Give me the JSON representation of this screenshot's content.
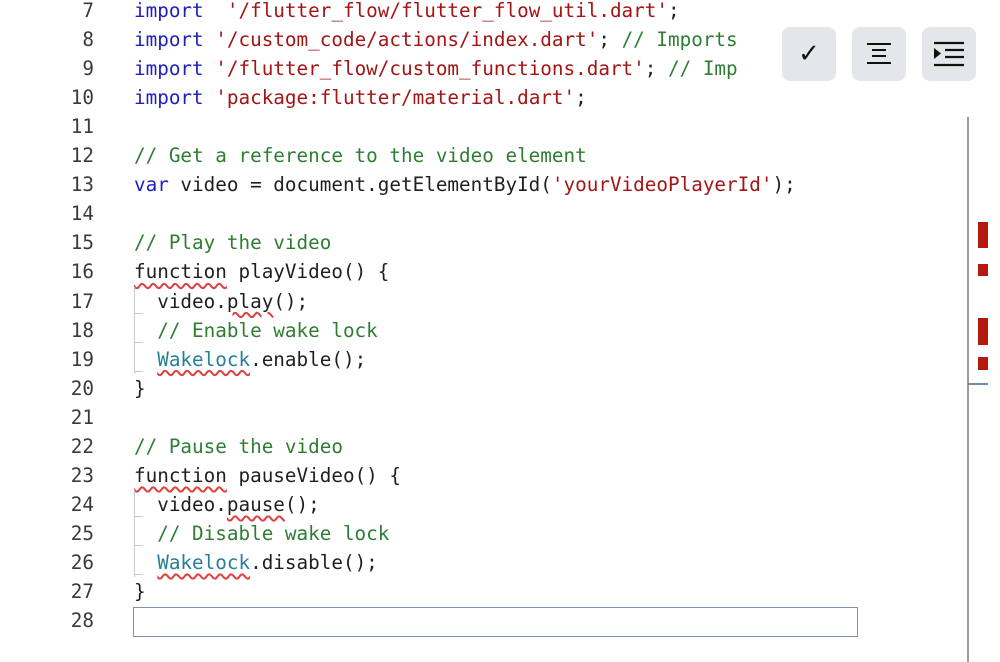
{
  "editor": {
    "lines": [
      {
        "n": "7",
        "tokens": [
          [
            "kw",
            "import"
          ],
          [
            "",
            "  "
          ],
          [
            "str",
            "'/flutter_flow/flutter_flow_util.dart'"
          ],
          [
            "",
            ";"
          ]
        ]
      },
      {
        "n": "8",
        "tokens": [
          [
            "kw",
            "import"
          ],
          [
            "",
            " "
          ],
          [
            "str",
            "'/custom_code/actions/index.dart'"
          ],
          [
            "",
            "; "
          ],
          [
            "com",
            "// Imports"
          ]
        ]
      },
      {
        "n": "9",
        "tokens": [
          [
            "kw",
            "import"
          ],
          [
            "",
            " "
          ],
          [
            "str",
            "'/flutter_flow/custom_functions.dart'"
          ],
          [
            "",
            "; "
          ],
          [
            "com",
            "// Imp"
          ]
        ]
      },
      {
        "n": "10",
        "tokens": [
          [
            "kw",
            "import"
          ],
          [
            "",
            " "
          ],
          [
            "str",
            "'package:flutter/material.dart'"
          ],
          [
            "",
            ";"
          ]
        ]
      },
      {
        "n": "11",
        "tokens": []
      },
      {
        "n": "12",
        "tokens": [
          [
            "com",
            "// Get a reference to the video element"
          ]
        ]
      },
      {
        "n": "13",
        "tokens": [
          [
            "kw",
            "var"
          ],
          [
            "",
            " video = document.getElementById("
          ],
          [
            "str",
            "'yourVideoPlayerId'"
          ],
          [
            "",
            ");"
          ]
        ]
      },
      {
        "n": "14",
        "tokens": []
      },
      {
        "n": "15",
        "tokens": [
          [
            "com",
            "// Play the video"
          ]
        ]
      },
      {
        "n": "16",
        "tokens": [
          [
            "err",
            "function"
          ],
          [
            "",
            " playVideo() {"
          ]
        ]
      },
      {
        "n": "17",
        "guide": true,
        "tokens": [
          [
            "",
            "  video."
          ],
          [
            "err",
            "play"
          ],
          [
            "",
            "();"
          ]
        ]
      },
      {
        "n": "18",
        "guide": true,
        "tokens": [
          [
            "",
            "  "
          ],
          [
            "com",
            "// Enable wake lock"
          ]
        ]
      },
      {
        "n": "19",
        "guide": true,
        "tokens": [
          [
            "",
            "  "
          ],
          [
            "type err",
            "Wakelock"
          ],
          [
            "",
            ".enable();"
          ]
        ]
      },
      {
        "n": "20",
        "tokens": [
          [
            "",
            "}"
          ]
        ]
      },
      {
        "n": "21",
        "tokens": []
      },
      {
        "n": "22",
        "tokens": [
          [
            "com",
            "// Pause the video"
          ]
        ]
      },
      {
        "n": "23",
        "tokens": [
          [
            "err",
            "function"
          ],
          [
            "",
            " pauseVideo() {"
          ]
        ]
      },
      {
        "n": "24",
        "guide": true,
        "tokens": [
          [
            "",
            "  video."
          ],
          [
            "err",
            "pause"
          ],
          [
            "",
            "();"
          ]
        ]
      },
      {
        "n": "25",
        "guide": true,
        "tokens": [
          [
            "",
            "  "
          ],
          [
            "com",
            "// Disable wake lock"
          ]
        ]
      },
      {
        "n": "26",
        "guide": true,
        "tokens": [
          [
            "",
            "  "
          ],
          [
            "type err",
            "Wakelock"
          ],
          [
            "",
            ".disable();"
          ]
        ]
      },
      {
        "n": "27",
        "tokens": [
          [
            "",
            "}"
          ]
        ]
      },
      {
        "n": "28",
        "tokens": [],
        "current": true
      }
    ]
  },
  "toolbar": {
    "buttons": [
      {
        "name": "check-button",
        "icon": "check-icon",
        "glyph": "✓"
      },
      {
        "name": "format-center-button",
        "icon": "align-center-icon"
      },
      {
        "name": "indent-button",
        "icon": "indent-icon"
      }
    ]
  },
  "overview_ruler": {
    "error_color": "#b3190f",
    "cursor_color": "#6a8cb8"
  }
}
